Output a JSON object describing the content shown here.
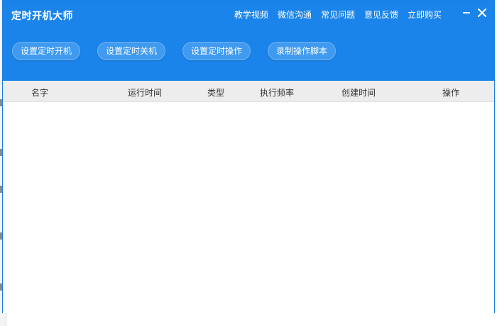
{
  "app": {
    "title": "定时开机大师"
  },
  "top_links": [
    {
      "label": "教学视频"
    },
    {
      "label": "微信沟通"
    },
    {
      "label": "常见问题"
    },
    {
      "label": "意见反馈"
    },
    {
      "label": "立即购买"
    }
  ],
  "window_controls": {
    "minimize_icon": "minimize-icon",
    "close_icon": "close-icon"
  },
  "actions": [
    {
      "label": "设置定时开机"
    },
    {
      "label": "设置定时关机"
    },
    {
      "label": "设置定时操作"
    },
    {
      "label": "录制操作脚本"
    }
  ],
  "table": {
    "columns": [
      {
        "label": "名字"
      },
      {
        "label": "运行时间"
      },
      {
        "label": "类型"
      },
      {
        "label": "执行频率"
      },
      {
        "label": "创建时间"
      },
      {
        "label": "操作"
      }
    ],
    "rows": []
  },
  "colors": {
    "header_bg": "#1a84ea",
    "button_bg": "#3f9af0",
    "table_header_bg": "#ededed"
  }
}
